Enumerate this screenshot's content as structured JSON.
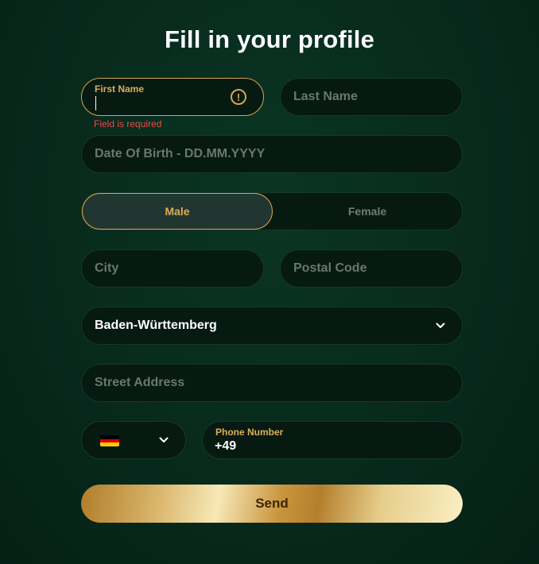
{
  "page": {
    "title": "Fill in your profile"
  },
  "form": {
    "first_name": {
      "label": "First Name",
      "value": "",
      "error": "Field is required",
      "warning_icon": "!"
    },
    "last_name": {
      "placeholder": "Last Name"
    },
    "dob": {
      "placeholder": "Date Of Birth - DD.MM.YYYY"
    },
    "gender": {
      "options": [
        "Male",
        "Female"
      ],
      "selected": "Male"
    },
    "city": {
      "placeholder": "City"
    },
    "postal_code": {
      "placeholder": "Postal Code"
    },
    "state": {
      "value": "Baden-Württemberg"
    },
    "street": {
      "placeholder": "Street Address"
    },
    "country_code": {
      "flag": "germany-flag",
      "colors": [
        "#000000",
        "#dd0000",
        "#ffce00"
      ]
    },
    "phone": {
      "label": "Phone Number",
      "value": "+49"
    },
    "submit_label": "Send"
  },
  "colors": {
    "accent": "#d8a44e",
    "error": "#ea4a4a",
    "field_bg": "#061a12",
    "background": "#07291c"
  }
}
